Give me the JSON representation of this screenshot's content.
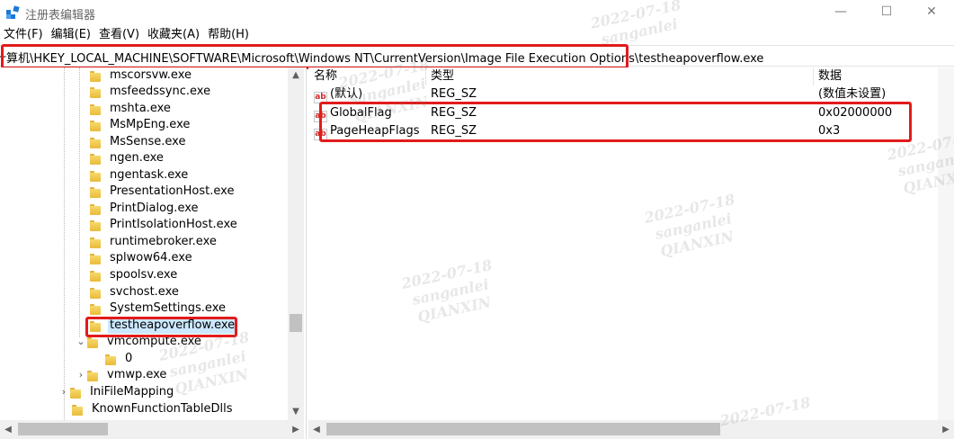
{
  "window": {
    "title": "注册表编辑器",
    "minimize": "—",
    "maximize": "☐",
    "close": "✕"
  },
  "menu": [
    "文件(F)",
    "编辑(E)",
    "查看(V)",
    "收藏夹(A)",
    "帮助(H)"
  ],
  "address": "计算机\\HKEY_LOCAL_MACHINE\\SOFTWARE\\Microsoft\\Windows NT\\CurrentVersion\\Image File Execution Options\\testheapoverflow.exe",
  "tree": {
    "items": [
      {
        "label": "mscorsvw.exe"
      },
      {
        "label": "msfeedssync.exe"
      },
      {
        "label": "mshta.exe"
      },
      {
        "label": "MsMpEng.exe"
      },
      {
        "label": "MsSense.exe"
      },
      {
        "label": "ngen.exe"
      },
      {
        "label": "ngentask.exe"
      },
      {
        "label": "PresentationHost.exe"
      },
      {
        "label": "PrintDialog.exe"
      },
      {
        "label": "PrintIsolationHost.exe"
      },
      {
        "label": "runtimebroker.exe"
      },
      {
        "label": "splwow64.exe"
      },
      {
        "label": "spoolsv.exe"
      },
      {
        "label": "svchost.exe"
      },
      {
        "label": "SystemSettings.exe"
      },
      {
        "label": "testheapoverflow.exe",
        "selected": true
      },
      {
        "label": "vmcompute.exe",
        "expanded": true
      },
      {
        "label": "0"
      },
      {
        "label": "vmwp.exe",
        "collapsed": true
      },
      {
        "label": "IniFileMapping",
        "collapsed": true
      },
      {
        "label": "KnownFunctionTableDlls"
      }
    ]
  },
  "values": {
    "headers": {
      "name": "名称",
      "type": "类型",
      "data": "数据"
    },
    "rows": [
      {
        "name": "(默认)",
        "type": "REG_SZ",
        "data": "(数值未设置)"
      },
      {
        "name": "GlobalFlag",
        "type": "REG_SZ",
        "data": "0x02000000"
      },
      {
        "name": "PageHeapFlags",
        "type": "REG_SZ",
        "data": "0x3"
      }
    ],
    "value_icon": "ab"
  },
  "watermark": {
    "date": "2022-07-18",
    "user": "sanganlei",
    "org": "QIANXIN"
  },
  "colors": {
    "highlight_box": "#e21b1b",
    "selection": "#cce8ff",
    "folder": "#f7d86b"
  }
}
